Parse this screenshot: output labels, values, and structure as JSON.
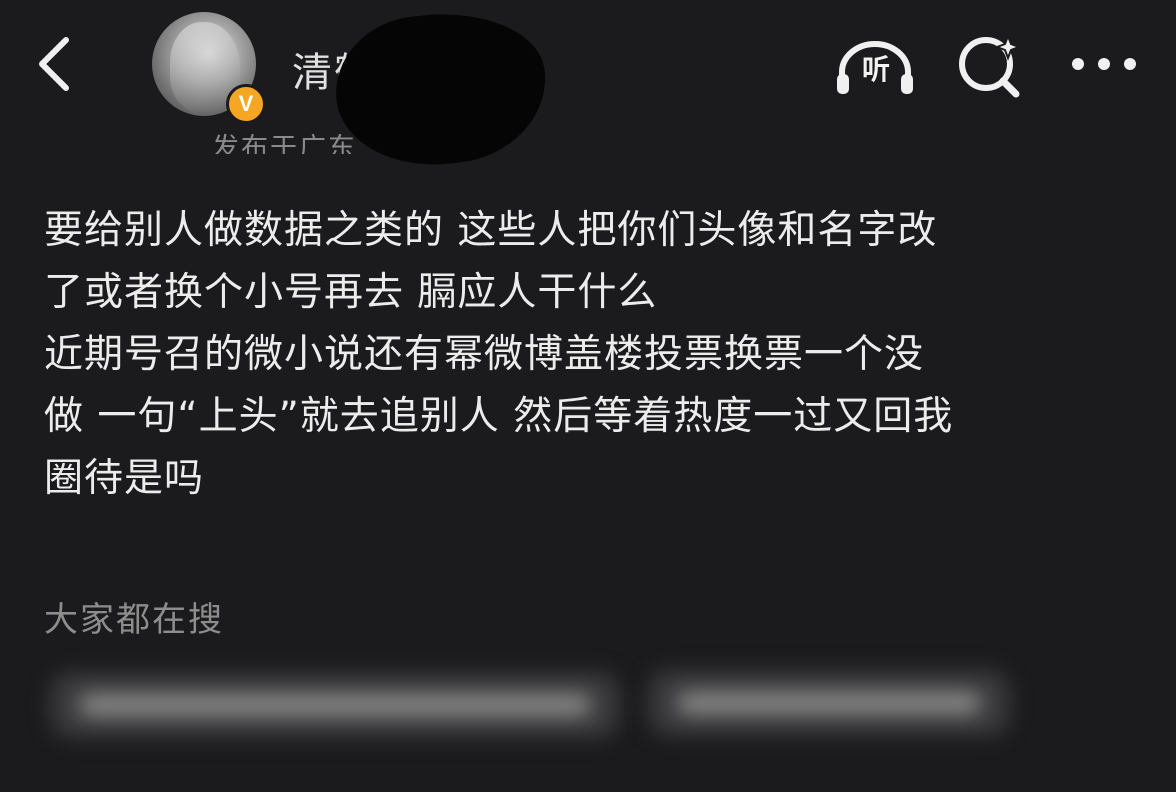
{
  "header": {
    "back_icon": "chevron-left-icon",
    "username_visible": "清鹤",
    "verified_badge": "V",
    "location": "发布于广东",
    "listen_label": "听",
    "listen_icon": "headphones-icon",
    "search_icon": "search-sparkle-icon",
    "more_icon": "more-dots-icon"
  },
  "post": {
    "text": "要给别人做数据之类的 这些人把你们头像和名字改\n了或者换个小号再去 膈应人干什么\n近期号召的微小说还有幂微博盖楼投票换票一个没\n做 一句“上头”就去追别人 然后等着热度一过又回我\n圈待是吗"
  },
  "trending": {
    "title": "大家都在搜"
  },
  "colors": {
    "background": "#1b1b1d",
    "badge": "#f5a623",
    "text": "#ececec",
    "muted": "#8d8d8d"
  }
}
